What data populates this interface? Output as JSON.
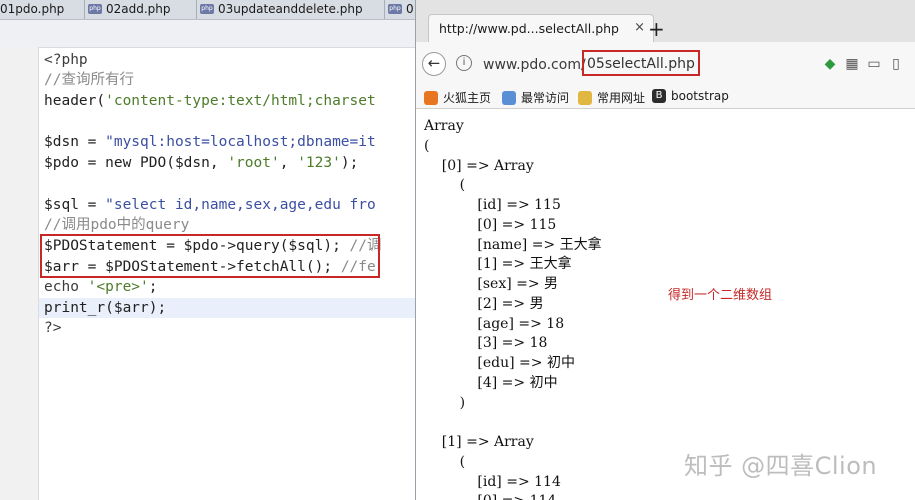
{
  "editor": {
    "tabs": [
      {
        "icon_label": "php",
        "label": "01pdo.php"
      },
      {
        "icon_label": "php",
        "label": "02add.php"
      },
      {
        "icon_label": "php",
        "label": "03updateanddelete.php"
      },
      {
        "icon_label": "php",
        "label": "0"
      }
    ],
    "code": {
      "l1": "<?php",
      "l2": "//查询所有行",
      "l3a": "header(",
      "l3b": "'content-type:text/html;charset",
      "l5a": "$dsn = ",
      "l5b": "\"mysql:host=localhost;dbname=it",
      "l6a": "$pdo = new PDO($dsn, ",
      "l6b": "'root'",
      "l6c": ", ",
      "l6d": "'123'",
      "l6e": ");",
      "l8a": "$sql = ",
      "l8b": "\"select id,name,sex,age,edu fro",
      "l9": "//调用pdo中的query",
      "l10a": "$PDOStatement = $pdo->query($sql); ",
      "l10b": "//调",
      "l11a": "$arr = $PDOStatement->fetchAll(); ",
      "l11b": "//fe",
      "l12a": "echo ",
      "l12b": "'<pre>'",
      "l12c": ";",
      "l13": "print_r($arr);",
      "l14": "?>"
    }
  },
  "browser": {
    "tab_title": "http://www.pd...selectAll.php",
    "tab_close": "×",
    "new_tab": "+",
    "back": "←",
    "info": "i",
    "url_host": "www.pdo.com/",
    "url_path": "05selectAll.php",
    "bookmarks": [
      "火狐主页",
      "最常访问",
      "常用网址",
      "bootstrap"
    ],
    "output": [
      "Array",
      "(",
      "    [0] => Array",
      "        (",
      "            [id] => 115",
      "            [0] => 115",
      "            [name] => 王大拿",
      "            [1] => 王大拿",
      "            [sex] => 男",
      "            [2] => 男",
      "            [age] => 18",
      "            [3] => 18",
      "            [edu] => 初中",
      "            [4] => 初中",
      "        )",
      "",
      "    [1] => Array",
      "        (",
      "            [id] => 114",
      "            [0] => 114"
    ],
    "annotation": "得到一个二维数组",
    "watermark": "知乎 @四喜Clion"
  },
  "colors": {
    "highlight_box": "#c62828",
    "comment": "#8a8a8a",
    "string": "#3b4fa3"
  }
}
